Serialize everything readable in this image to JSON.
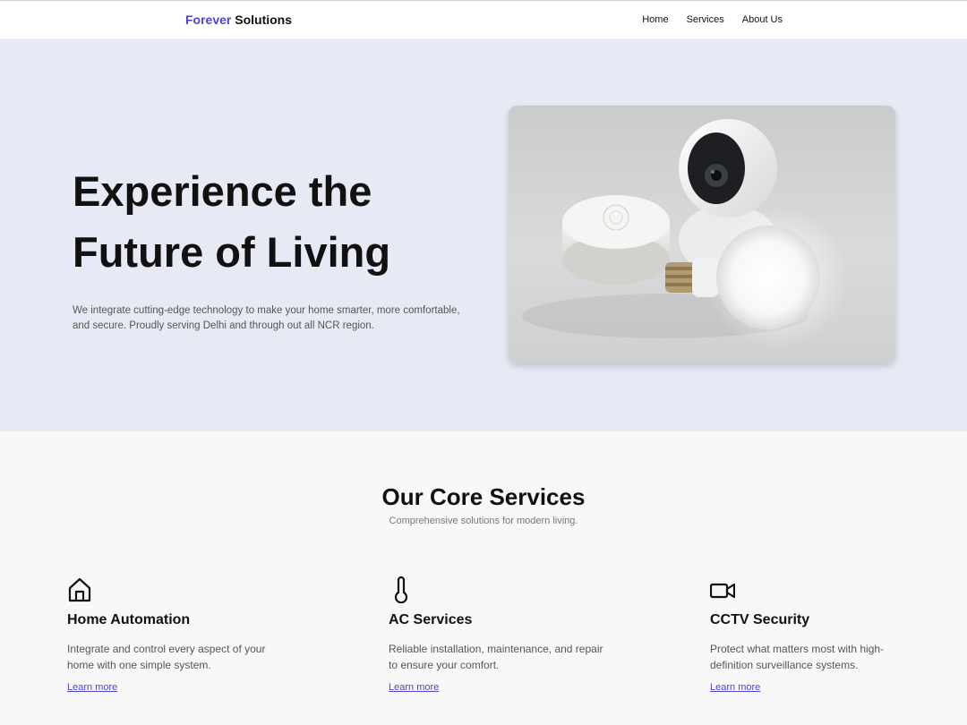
{
  "nav": {
    "brand_accent": "Forever",
    "brand_rest": "Solutions",
    "links": [
      "Home",
      "Services",
      "About Us"
    ]
  },
  "hero": {
    "title_line1": "Experience the",
    "title_line2": "Future of Living",
    "description": "We integrate cutting-edge technology to make your home smarter, more comfortable, and secure. Proudly serving Delhi and through out all NCR region."
  },
  "services": {
    "title": "Our Core Services",
    "subtitle": "Comprehensive solutions for modern living.",
    "cards": [
      {
        "icon": "home-icon",
        "title": "Home Automation",
        "description": "Integrate and control every aspect of your home with one simple system.",
        "link": "Learn more"
      },
      {
        "icon": "thermometer-icon",
        "title": "AC Services",
        "description": "Reliable installation, maintenance, and repair to ensure your comfort.",
        "link": "Learn more"
      },
      {
        "icon": "video-camera-icon",
        "title": "CCTV Security",
        "description": "Protect what matters most with high-definition surveillance systems.",
        "link": "Learn more"
      }
    ]
  },
  "colors": {
    "accent": "#4f46c8",
    "hero_bg": "#e7eaf5",
    "section_bg": "#f8f8f9"
  }
}
